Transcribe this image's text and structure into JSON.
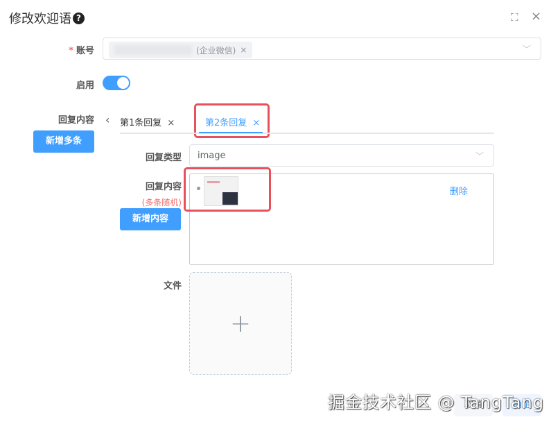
{
  "dialog": {
    "title": "修改欢迎语",
    "help_icon": "?",
    "fullscreen_icon": "⛶",
    "close_icon": "×"
  },
  "account": {
    "label": "账号",
    "required": "*",
    "tag_suffix": "(企业微信)",
    "tag_close": "×"
  },
  "enable": {
    "label": "启用",
    "on": true
  },
  "reply_content": {
    "label": "回复内容",
    "add_more_button": "新增多条"
  },
  "tabs": [
    {
      "label": "第1条回复",
      "close": "×",
      "active": false
    },
    {
      "label": "第2条回复",
      "close": "×",
      "active": true
    }
  ],
  "reply_type": {
    "label": "回复类型",
    "value": "image"
  },
  "content": {
    "label": "回复内容",
    "sub_label": "(多条随机)",
    "add_button": "新增内容",
    "delete_link": "删除"
  },
  "file": {
    "label": "文件",
    "plus": "+"
  },
  "footer": {
    "cancel": "取消",
    "confirm": "确定"
  },
  "watermark": "掘金技术社区 @ TangTang",
  "colors": {
    "primary": "#409eff",
    "highlight": "#e8505b",
    "required": "#f56c6c"
  }
}
